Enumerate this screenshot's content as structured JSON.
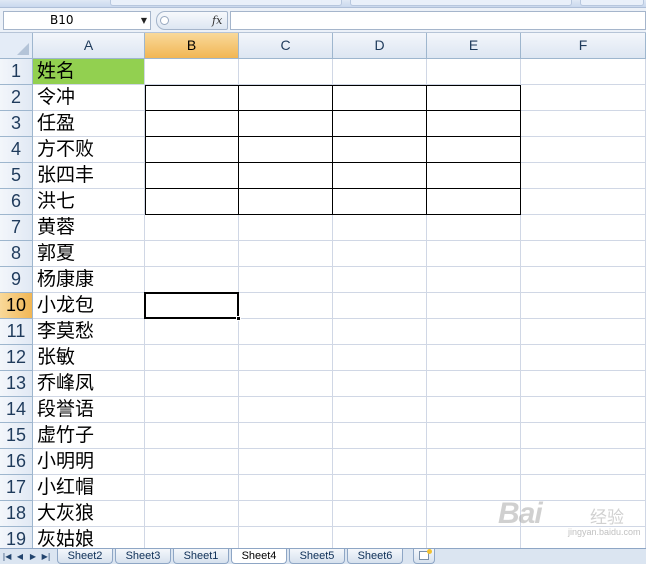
{
  "formula_bar": {
    "name_box": "B10",
    "fx_label": "fx",
    "formula_value": ""
  },
  "columns": [
    "A",
    "B",
    "C",
    "D",
    "E",
    "F"
  ],
  "rows": [
    "1",
    "2",
    "3",
    "4",
    "5",
    "6",
    "7",
    "8",
    "9",
    "10",
    "11",
    "12",
    "13",
    "14",
    "15",
    "16",
    "17",
    "18",
    "19"
  ],
  "column_a": [
    "姓名",
    "令冲",
    "任盈",
    "方不败",
    "张四丰",
    "洪七",
    "黄蓉",
    "郭夏",
    "杨康康",
    "小龙包",
    "李莫愁",
    "张敏",
    "乔峰凤",
    "段誉语",
    "虚竹子",
    "小明明",
    "小红帽",
    "大灰狼",
    "灰姑娘"
  ],
  "active_cell": {
    "column": "B",
    "row": "10"
  },
  "bordered_range": "B2:E6",
  "sheet_tabs": [
    "Sheet2",
    "Sheet3",
    "Sheet1",
    "Sheet4",
    "Sheet5",
    "Sheet6"
  ],
  "active_sheet": "Sheet4",
  "colors": {
    "header_fill": "#92d050",
    "active_header": "#f1b654",
    "gridline": "#d0d7e5",
    "header_bg": "#dde6f2"
  },
  "watermark": {
    "logo": "Bai",
    "sub": "经验",
    "url": "jingyan.baidu.com"
  }
}
